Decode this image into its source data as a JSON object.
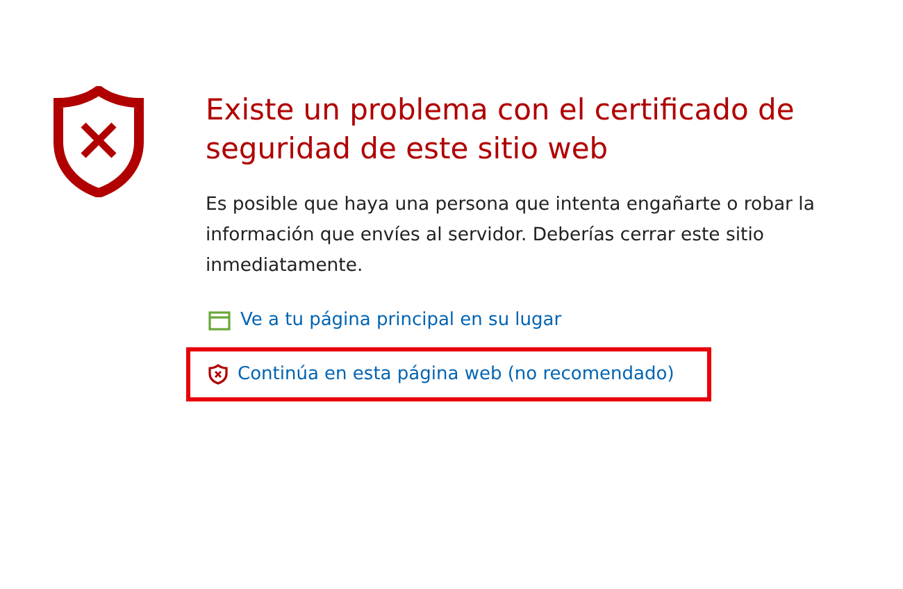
{
  "title": "Existe un problema con el certificado de seguridad de este sitio web",
  "message": "Es posible que haya una persona que intenta engañarte o robar la información que envíes al servidor. Deberías cerrar este sitio inmediatamente.",
  "links": [
    {
      "kind": "home",
      "label": "Ve a tu página principal en su lugar",
      "highlighted": false
    },
    {
      "kind": "continue",
      "label": "Continúa en esta página web (no recomendado)",
      "highlighted": true
    }
  ]
}
